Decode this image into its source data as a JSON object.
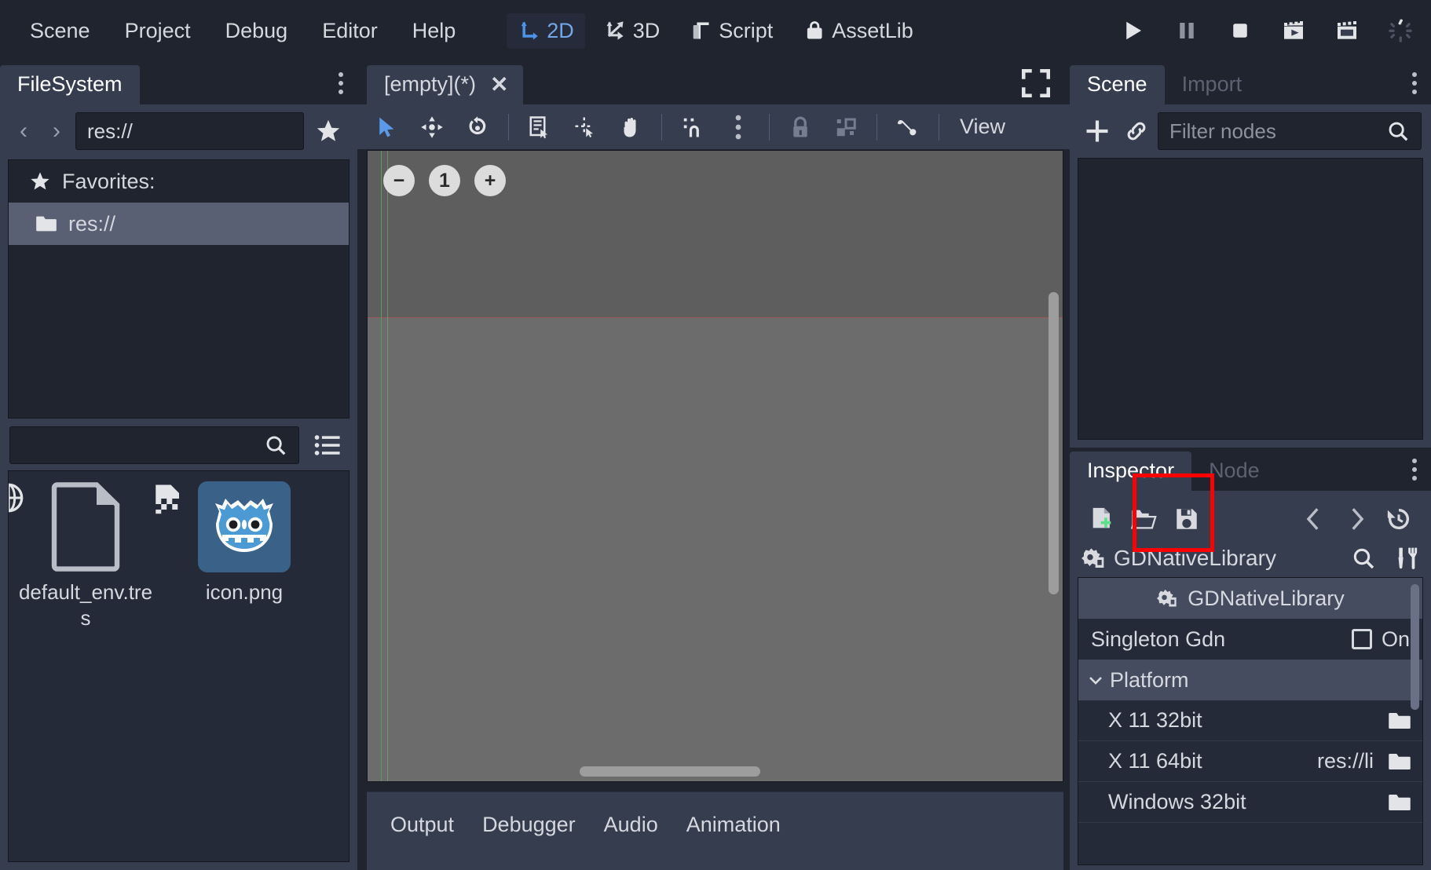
{
  "menubar": {
    "items": [
      {
        "label": "Scene",
        "name": "menu-scene"
      },
      {
        "label": "Project",
        "name": "menu-project"
      },
      {
        "label": "Debug",
        "name": "menu-debug"
      },
      {
        "label": "Editor",
        "name": "menu-editor"
      },
      {
        "label": "Help",
        "name": "menu-help"
      }
    ],
    "main_tabs": [
      {
        "label": "2D",
        "icon": "2d-icon",
        "active": true
      },
      {
        "label": "3D",
        "icon": "3d-icon",
        "active": false
      },
      {
        "label": "Script",
        "icon": "script-icon",
        "active": false
      },
      {
        "label": "AssetLib",
        "icon": "assetlib-icon",
        "active": false
      }
    ],
    "play_controls": [
      {
        "name": "play-button",
        "icon": "play-icon"
      },
      {
        "name": "pause-button",
        "icon": "pause-icon"
      },
      {
        "name": "stop-button",
        "icon": "stop-icon"
      },
      {
        "name": "play-scene-button",
        "icon": "clapperboard-play-icon"
      },
      {
        "name": "play-custom-scene-button",
        "icon": "clapperboard-icon"
      },
      {
        "name": "loading-spinner",
        "icon": "spinner-icon"
      }
    ],
    "accent_color": "#74a7e8"
  },
  "filesystem": {
    "tabs": [
      {
        "label": "FileSystem",
        "active": true
      }
    ],
    "path_value": "res://",
    "nav_back": "‹",
    "nav_forward": "›",
    "favorite_icon": "star-icon",
    "tree": [
      {
        "label": "Favorites:",
        "icon": "star-icon",
        "selected": false
      },
      {
        "label": "res://",
        "icon": "folder-icon",
        "selected": true
      }
    ],
    "search_value": "",
    "search_placeholder": "",
    "files": [
      {
        "name": "default_env.tres",
        "icon": "resource-file-icon",
        "badge": "globe-icon",
        "selected": false
      },
      {
        "name": "icon.png",
        "icon": "godot-robot-icon",
        "badge": "image-file-icon",
        "selected": true
      }
    ]
  },
  "viewport": {
    "scene_tab": {
      "label": "[empty](*)",
      "close": "✕"
    },
    "maximize_icon": "maximize-icon",
    "toolbar": [
      {
        "name": "select-mode-button",
        "icon": "cursor-arrow-icon",
        "active": true
      },
      {
        "name": "move-mode-button",
        "icon": "move-icon",
        "active": false
      },
      {
        "name": "rotate-mode-button",
        "icon": "rotate-icon",
        "active": false
      },
      {
        "name": "list-select-button",
        "icon": "list-select-icon",
        "active": false
      },
      {
        "name": "ruler-mode-button",
        "icon": "ruler-icon",
        "active": false
      },
      {
        "name": "pan-mode-button",
        "icon": "hand-icon",
        "active": false
      },
      {
        "name": "snap-mode-button",
        "icon": "snap-icon",
        "active": false
      },
      {
        "name": "snap-options-button",
        "icon": "vertical-dots-icon",
        "active": false
      },
      {
        "name": "lock-button",
        "icon": "lock-icon",
        "active": false
      },
      {
        "name": "group-button",
        "icon": "group-icon",
        "active": false
      },
      {
        "name": "skeleton-button",
        "icon": "bone-icon",
        "active": false
      }
    ],
    "view_label": "View",
    "zoom_controls": {
      "minus": "−",
      "level": "1",
      "plus": "+"
    }
  },
  "bottom_panel": {
    "tabs": [
      "Output",
      "Debugger",
      "Audio",
      "Animation"
    ]
  },
  "scene_dock": {
    "tabs": [
      {
        "label": "Scene",
        "active": true
      },
      {
        "label": "Import",
        "active": false
      }
    ],
    "toolbar": [
      {
        "name": "add-node-button",
        "icon": "plus-icon"
      },
      {
        "name": "instance-scene-button",
        "icon": "link-icon"
      }
    ],
    "filter_value": "",
    "filter_placeholder": "Filter nodes",
    "search_icon": "search-icon",
    "nodes": []
  },
  "inspector": {
    "tabs": [
      {
        "label": "Inspector",
        "active": true
      },
      {
        "label": "Node",
        "active": false
      }
    ],
    "toolbar": [
      {
        "name": "new-resource-button",
        "icon": "new-resource-icon"
      },
      {
        "name": "load-resource-button",
        "icon": "folder-open-icon"
      },
      {
        "name": "save-resource-button",
        "icon": "save-floppy-icon",
        "highlighted": true
      },
      {
        "name": "history-back-button",
        "icon": "chevron-left-icon"
      },
      {
        "name": "history-forward-button",
        "icon": "chevron-right-icon"
      },
      {
        "name": "history-button",
        "icon": "history-icon"
      }
    ],
    "resource_name": "GDNativeLibrary",
    "resource_icon": "gdnativelibrary-icon",
    "resource_search_icon": "search-icon",
    "resource_tools_icon": "tools-icon",
    "highlight_color": "#ff0000",
    "property_header": {
      "label": "GDNativeLibrary",
      "icon": "gdnativelibrary-icon"
    },
    "properties": [
      {
        "label": "Singleton Gdn",
        "value": "On",
        "control": "checkbox",
        "checked": false
      }
    ],
    "categories": [
      {
        "label": "Platform",
        "expanded": true,
        "chevron": "⌄",
        "rows": [
          {
            "label": "X 11 32bit",
            "value": "",
            "icon": "folder-icon"
          },
          {
            "label": "X 11 64bit",
            "value": "res://li",
            "icon": "folder-icon"
          },
          {
            "label": "Windows 32bit",
            "value": "",
            "icon": "folder-icon"
          }
        ]
      }
    ]
  },
  "theme": {
    "bg_dark": "#20242f",
    "panel": "#363d4f",
    "inset": "#252a38",
    "text": "#d5d8de",
    "muted": "#5d6272",
    "viewport_bg": "#6c6c6c"
  }
}
